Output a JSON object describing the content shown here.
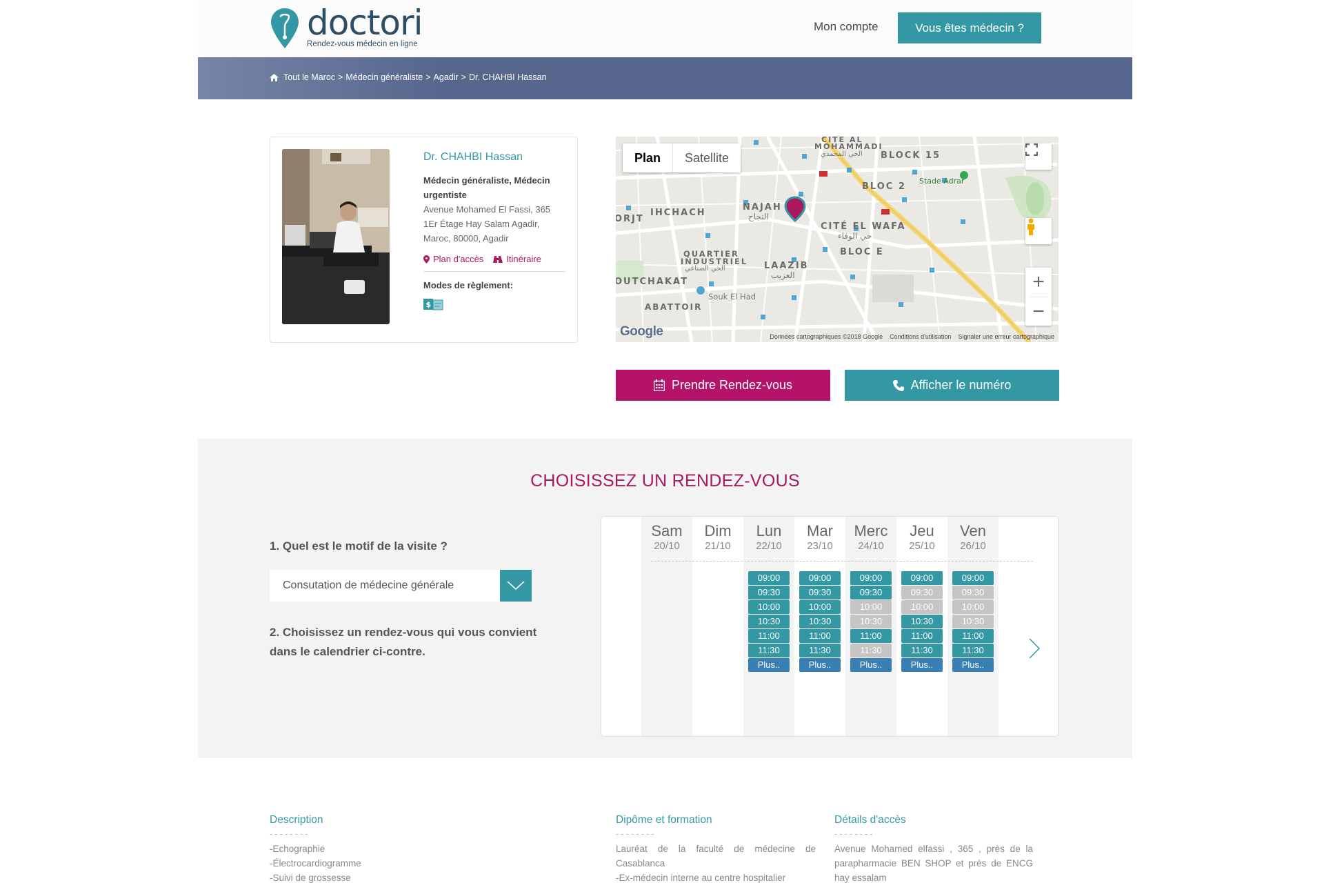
{
  "header": {
    "logo_word": "doctori",
    "logo_tagline": "Rendez-vous médecin en ligne",
    "account_link": "Mon compte",
    "doctor_button": "Vous êtes médecin ?"
  },
  "breadcrumb": [
    "Tout le Maroc",
    "Médecin généraliste",
    "Agadir",
    "Dr. CHAHBI Hassan"
  ],
  "doctor": {
    "name": "Dr. CHAHBI Hassan",
    "specialty": "Médecin généraliste, Médecin urgentiste",
    "address": "Avenue Mohamed El Fassi, 365 1Er Étage Hay Salam Agadir, Maroc, 80000, Agadir",
    "plan_link": "Plan d'accès",
    "itinerary_link": "Itinéraire",
    "payment_title": "Modes de règlement:"
  },
  "map": {
    "tab_plan": "Plan",
    "tab_satellite": "Satellite",
    "labels": {
      "cite_al": "CITE AL",
      "mohammadi": "MOHAMMADI",
      "mohammadi_ar": "الحي المحمدي",
      "block15": "BLOCK 15",
      "bloc2": "BLOC 2",
      "stade": "Stade Adrar",
      "ihchach": "IHCHACH",
      "najah": "NAJAH",
      "najah_ar": "النجاح",
      "orjt": "ORJT",
      "cite_wafa": "CITÉ EL WAFA",
      "wafa_ar": "حي الوفاء",
      "bloc_e": "BLOC E",
      "quartier": "QUARTIER",
      "industriel": "INDUSTRIEL",
      "industriel_ar": "الحي الصناعي",
      "laazib": "LAAZIB",
      "laazib_ar": "العزيب",
      "outchakat": "OUTCHAKAT",
      "souk": "Souk El Had",
      "abattoir": "ABATTOIR"
    },
    "google": "Google",
    "footer": [
      "Données cartographiques ©2018 Google",
      "Conditions d'utilisation",
      "Signaler une erreur cartographique"
    ]
  },
  "actions": {
    "book": "Prendre Rendez-vous",
    "phone": "Afficher le numéro"
  },
  "booking": {
    "title": "CHOISISSEZ UN RENDEZ-VOUS",
    "q1": "1. Quel est le motif de la visite ?",
    "motif": "Consutation de médecine générale",
    "q2": "2. Choisissez un rendez-vous qui vous convient dans le calendrier ci-contre."
  },
  "calendar": {
    "days": [
      {
        "name": "Sam",
        "date": "20/10",
        "slots": []
      },
      {
        "name": "Dim",
        "date": "21/10",
        "slots": []
      },
      {
        "name": "Lun",
        "date": "22/10",
        "slots": [
          [
            "09:00",
            true
          ],
          [
            "09:30",
            true
          ],
          [
            "10:00",
            true
          ],
          [
            "10:30",
            true
          ],
          [
            "11:00",
            true
          ],
          [
            "11:30",
            true
          ],
          [
            "Plus..",
            true
          ]
        ]
      },
      {
        "name": "Mar",
        "date": "23/10",
        "slots": [
          [
            "09:00",
            true
          ],
          [
            "09:30",
            true
          ],
          [
            "10:00",
            true
          ],
          [
            "10:30",
            true
          ],
          [
            "11:00",
            true
          ],
          [
            "11:30",
            true
          ],
          [
            "Plus..",
            true
          ]
        ]
      },
      {
        "name": "Merc",
        "date": "24/10",
        "slots": [
          [
            "09:00",
            true
          ],
          [
            "09:30",
            true
          ],
          [
            "10:00",
            false
          ],
          [
            "10:30",
            false
          ],
          [
            "11:00",
            true
          ],
          [
            "11:30",
            false
          ],
          [
            "Plus..",
            true
          ]
        ]
      },
      {
        "name": "Jeu",
        "date": "25/10",
        "slots": [
          [
            "09:00",
            true
          ],
          [
            "09:30",
            false
          ],
          [
            "10:00",
            false
          ],
          [
            "10:30",
            true
          ],
          [
            "11:00",
            true
          ],
          [
            "11:30",
            true
          ],
          [
            "Plus..",
            true
          ]
        ]
      },
      {
        "name": "Ven",
        "date": "26/10",
        "slots": [
          [
            "09:00",
            true
          ],
          [
            "09:30",
            false
          ],
          [
            "10:00",
            false
          ],
          [
            "10:30",
            false
          ],
          [
            "11:00",
            true
          ],
          [
            "11:30",
            true
          ],
          [
            "Plus..",
            true
          ]
        ]
      }
    ]
  },
  "sections": {
    "description_title": "Description",
    "description_items": [
      "-Echographie",
      "-Électrocardiogramme",
      "-Suivi de grossesse"
    ],
    "diploma_title": "Dipôme et formation",
    "diploma_text_1": "Lauréat de la faculté de médecine de Casablanca",
    "diploma_text_2": "-Ex-médecin interne au centre hospitalier",
    "access_title": "Détails d'accès",
    "access_text": "Avenue Mohamed elfassi , 365 , près de la parapharmacie BEN SHOP et près de ENCG hay essalam",
    "dashes": "--------"
  },
  "colors": {
    "teal": "#3398a3",
    "magenta": "#b5136a",
    "title_magenta": "#a8195d",
    "navy": "#2e4e64",
    "banner": "#56668c"
  }
}
